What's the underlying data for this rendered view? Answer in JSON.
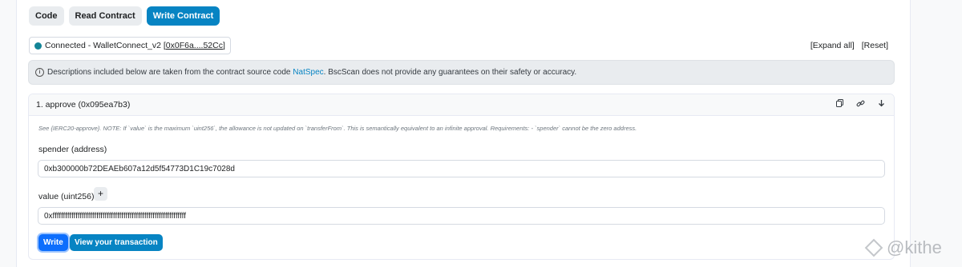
{
  "tabs": [
    {
      "label": "Code"
    },
    {
      "label": "Read Contract"
    },
    {
      "label": "Write Contract"
    }
  ],
  "connection": {
    "text": "Connected - WalletConnect_v2 ",
    "open_bracket": "[",
    "address": "0x0F6a....52Cc",
    "close_bracket": "]"
  },
  "controls": {
    "expand_all": "[Expand all]",
    "reset": "[Reset]"
  },
  "notice": {
    "icon": "i",
    "text_before": "Descriptions included below are taken from the contract source code ",
    "link": "NatSpec",
    "text_after": ". BscScan does not provide any guarantees on their safety or accuracy."
  },
  "method": {
    "title": "1. approve (0x095ea7b3)",
    "description": "See {IERC20-approve}. NOTE: If `value` is the maximum `uint256`, the allowance is not updated on `transferFrom`. This is semantically equivalent to an infinite approval. Requirements: - `spender` cannot be the zero address.",
    "spender_label": "spender (address)",
    "spender_value": "0xb300000b72DEAEb607a12d5f54773D1C19c7028d",
    "value_label": "value (uint256)",
    "plus": "+",
    "value_value": "0xffffffffffffffffffffffffffffffffffffffffffffffffffffffffffffffff",
    "write_button": "Write",
    "view_button": "View your transaction"
  },
  "icons": {
    "copy": "copy-icon",
    "link": "link-icon",
    "arrow": "arrow-down-icon"
  },
  "watermark": {
    "text": "@kithe"
  },
  "colors": {
    "accent": "#0784c3",
    "connected_dot": "#138496"
  }
}
